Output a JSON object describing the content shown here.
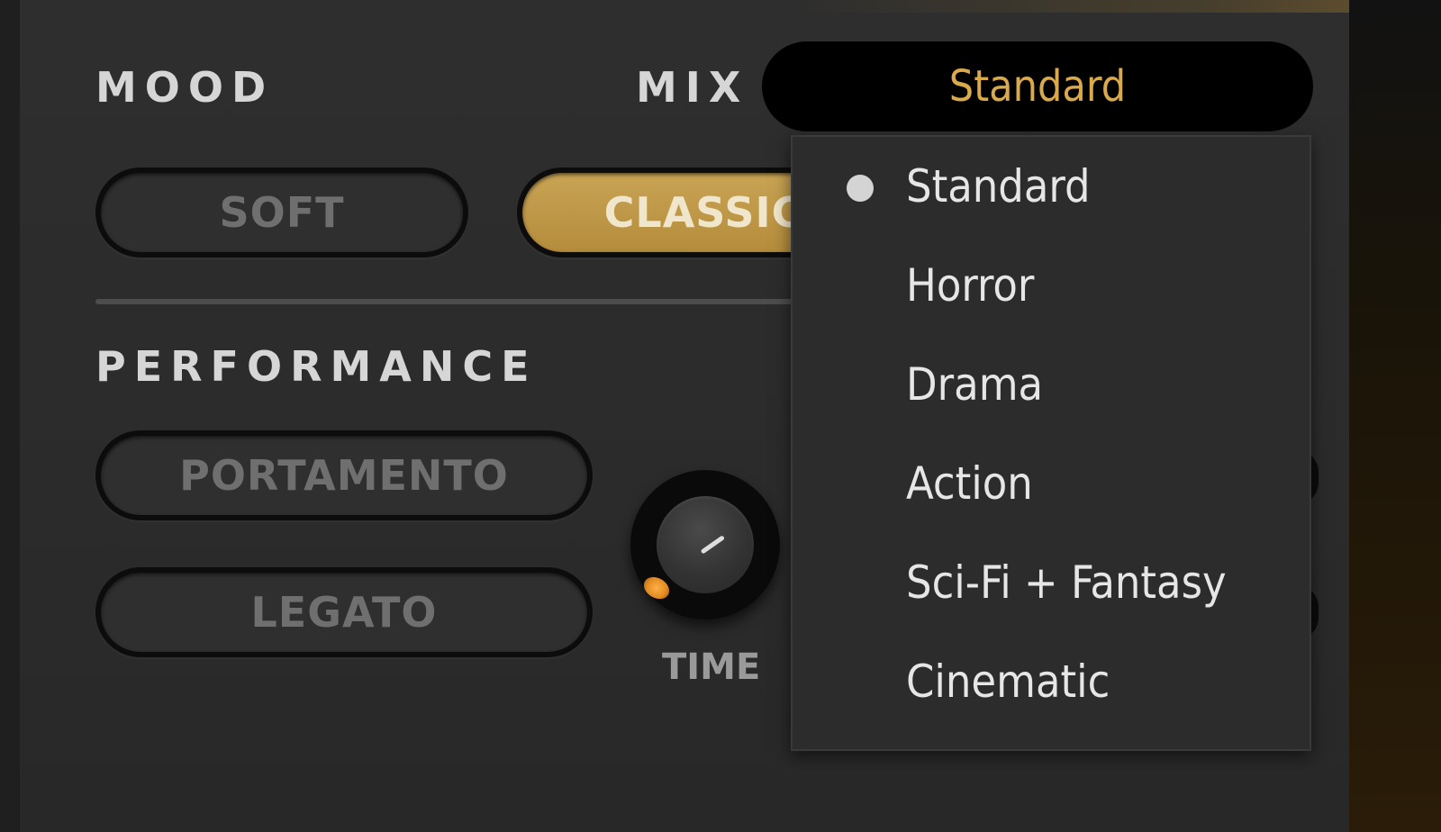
{
  "mood": {
    "title": "MOOD",
    "buttons": [
      {
        "label": "SOFT",
        "active": false
      },
      {
        "label": "CLASSIC",
        "active": true
      }
    ]
  },
  "mix": {
    "title": "MIX",
    "selected": "Standard",
    "options": [
      "Standard",
      "Horror",
      "Drama",
      "Action",
      "Sci-Fi + Fantasy",
      "Cinematic"
    ]
  },
  "performance": {
    "title": "PERFORMANCE",
    "buttons": [
      {
        "label": "PORTAMENTO",
        "active": false
      },
      {
        "label": "LEGATO",
        "active": false
      }
    ],
    "knob": {
      "label": "TIME"
    }
  },
  "colors": {
    "accent": "#d9a94b",
    "active_pill": "#c9a454",
    "panel": "#2c2c2c"
  }
}
